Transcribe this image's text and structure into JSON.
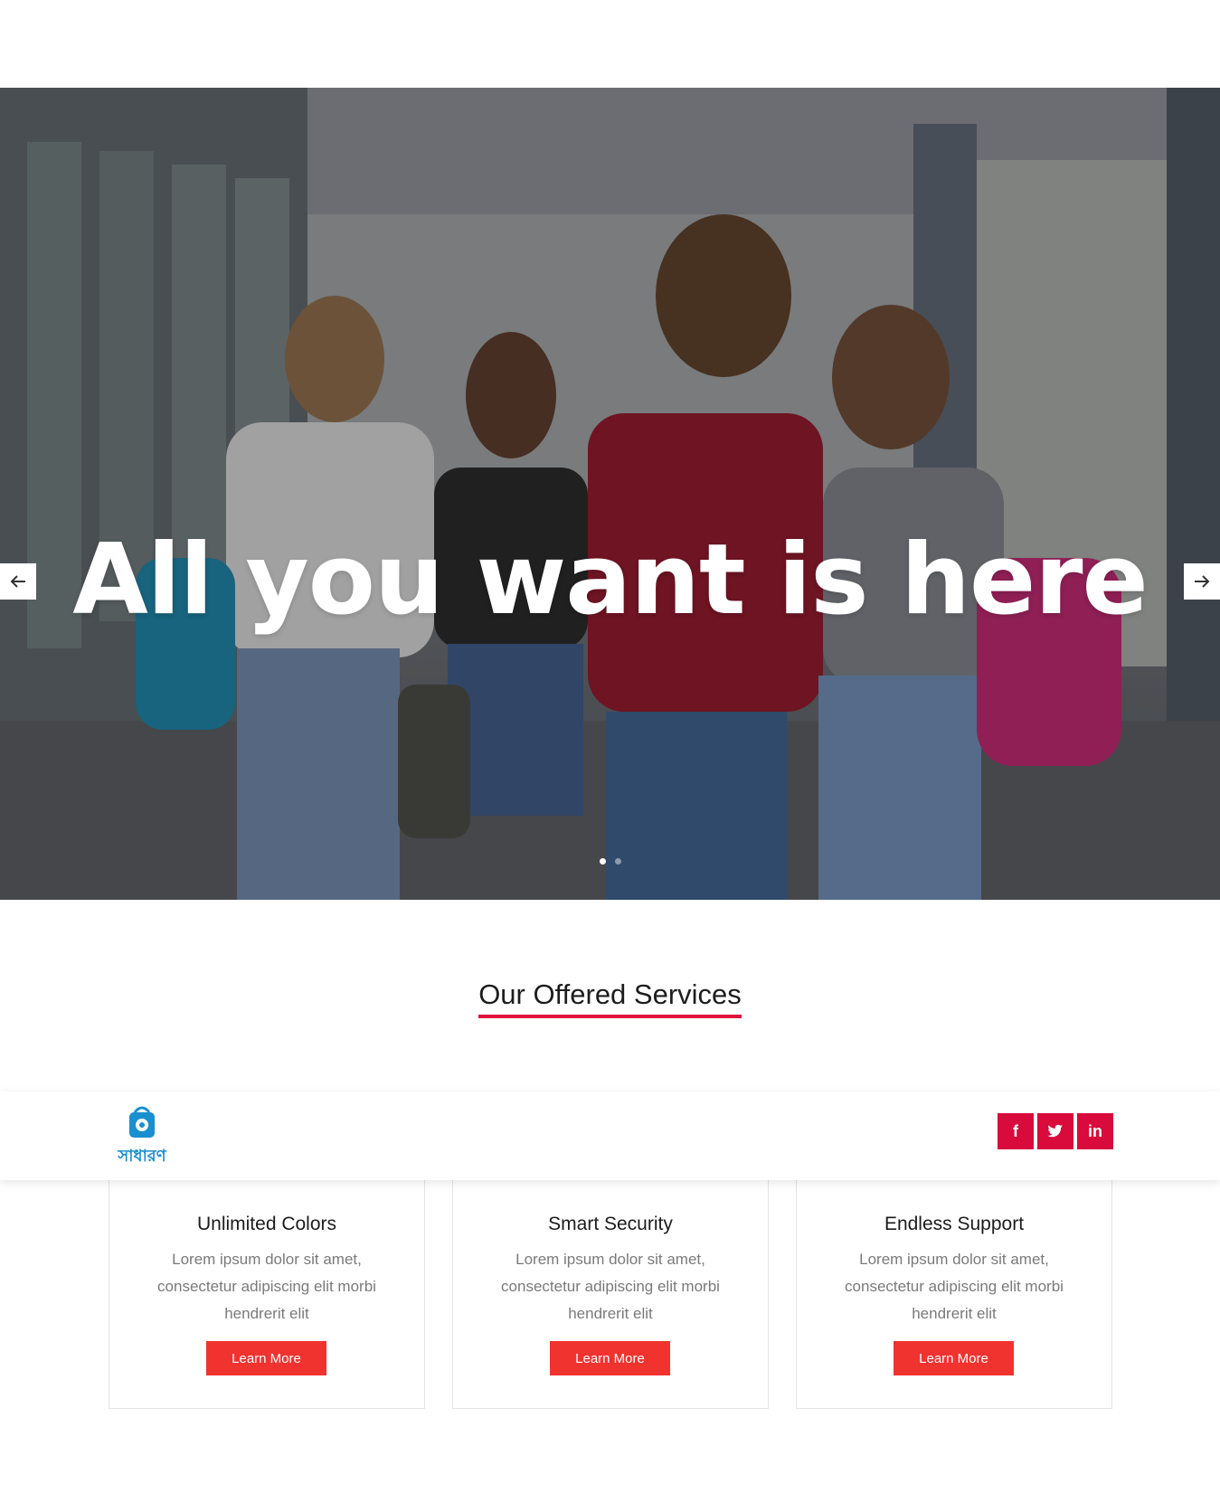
{
  "hero": {
    "title": "All you want is here",
    "slides": [
      {
        "active": true
      },
      {
        "active": false
      }
    ]
  },
  "services": {
    "heading": "Our Offered Services",
    "items": [
      {
        "title": "Unlimited Colors",
        "text": "Lorem ipsum dolor sit amet, consectetur adipiscing elit morbi hendrerit elit",
        "button": "Learn More"
      },
      {
        "title": "Smart Security",
        "text": "Lorem ipsum dolor sit amet, consectetur adipiscing elit morbi hendrerit elit",
        "button": "Learn More"
      },
      {
        "title": "Endless Support",
        "text": "Lorem ipsum dolor sit amet, consectetur adipiscing elit morbi hendrerit elit",
        "button": "Learn More"
      }
    ]
  },
  "header": {
    "logo_text": "সাধারণ",
    "social": [
      {
        "icon": "facebook-icon",
        "glyph": "f"
      },
      {
        "icon": "twitter-icon",
        "glyph": "🐦"
      },
      {
        "icon": "linkedin-icon",
        "glyph": "in"
      }
    ]
  },
  "colors": {
    "accent": "#e0123f",
    "button": "#f0332f",
    "social": "#d90a3c",
    "logo": "#1a8fd0"
  }
}
